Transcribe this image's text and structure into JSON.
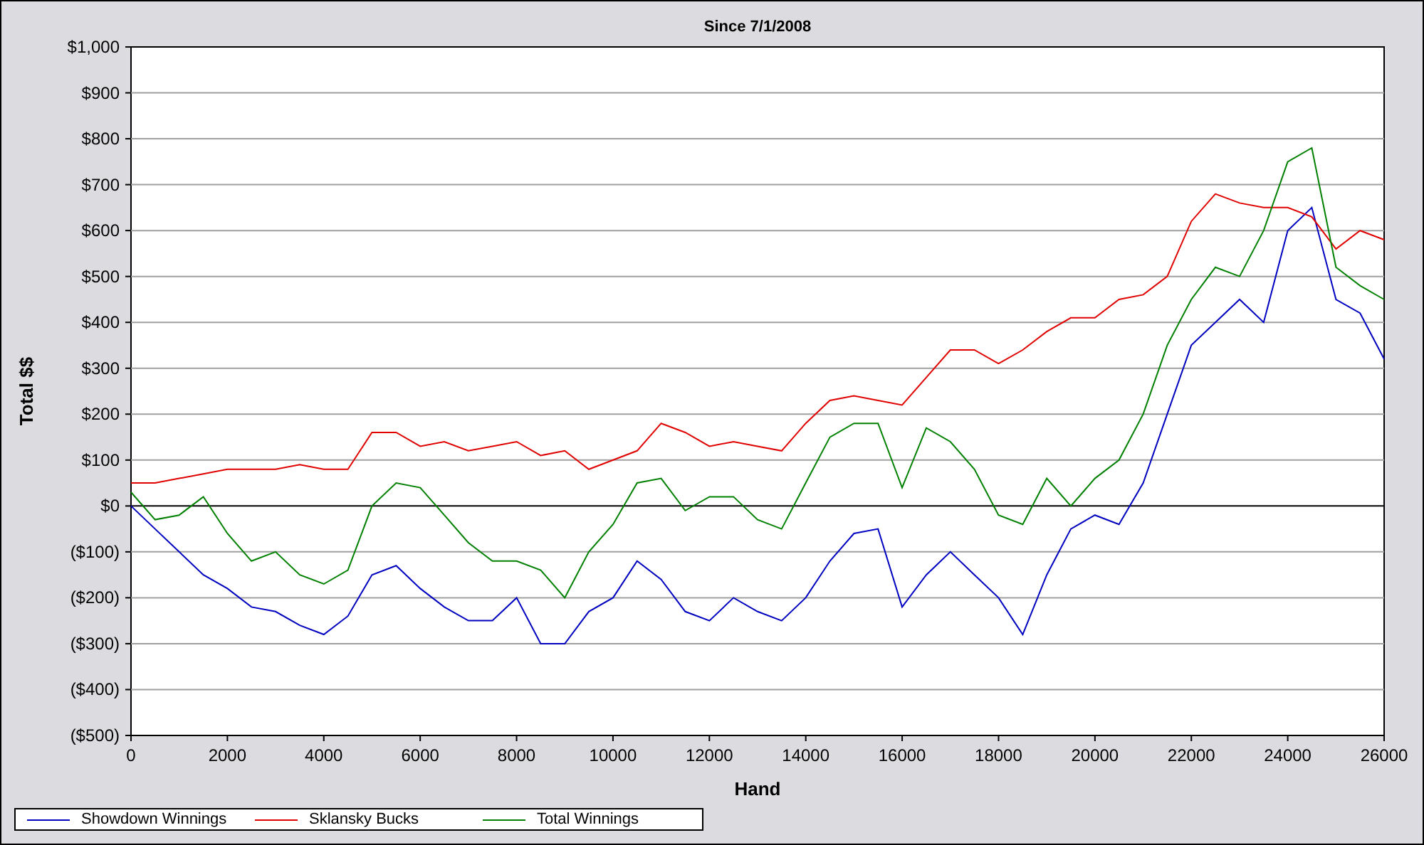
{
  "chart": {
    "chart_data": {
      "type": "line",
      "grid": true,
      "title": "Since 7/1/2008",
      "xlabel": "Hand",
      "ylabel": "Total $$",
      "x": [
        0,
        500,
        1000,
        1500,
        2000,
        2500,
        3000,
        3500,
        4000,
        4500,
        5000,
        5500,
        6000,
        6500,
        7000,
        7500,
        8000,
        8500,
        9000,
        9500,
        10000,
        10500,
        11000,
        11500,
        12000,
        12500,
        13000,
        13500,
        14000,
        14500,
        15000,
        15500,
        16000,
        16500,
        17000,
        17500,
        18000,
        18500,
        19000,
        19500,
        20000,
        20500,
        21000,
        21500,
        22000,
        22500,
        23000,
        23500,
        24000,
        24500,
        25000,
        25500,
        26000
      ],
      "series": [
        {
          "name": "Showdown Winnings",
          "color": "#0000c0",
          "values": [
            0,
            -50,
            -100,
            -150,
            -180,
            -220,
            -230,
            -260,
            -280,
            -240,
            -150,
            -130,
            -180,
            -220,
            -250,
            -250,
            -200,
            -300,
            -300,
            -230,
            -200,
            -120,
            -160,
            -230,
            -250,
            -200,
            -230,
            -250,
            -200,
            -120,
            -60,
            -50,
            -220,
            -150,
            -100,
            -150,
            -200,
            -280,
            -150,
            -50,
            -20,
            -40,
            50,
            200,
            350,
            400,
            450,
            400,
            600,
            650,
            450,
            420,
            320
          ]
        },
        {
          "name": "Sklansky Bucks",
          "color": "#e00000",
          "values": [
            50,
            50,
            60,
            70,
            80,
            80,
            80,
            90,
            80,
            80,
            160,
            160,
            130,
            140,
            120,
            130,
            140,
            110,
            120,
            80,
            100,
            120,
            180,
            160,
            130,
            140,
            130,
            120,
            180,
            230,
            240,
            230,
            220,
            280,
            340,
            340,
            310,
            340,
            380,
            410,
            410,
            450,
            460,
            500,
            620,
            680,
            660,
            650,
            650,
            630,
            560,
            600,
            580
          ]
        },
        {
          "name": "Total Winnings",
          "color": "#008000",
          "values": [
            30,
            -30,
            -20,
            20,
            -60,
            -120,
            -100,
            -150,
            -170,
            -140,
            0,
            50,
            40,
            -20,
            -80,
            -120,
            -120,
            -140,
            -200,
            -100,
            -40,
            50,
            60,
            -10,
            20,
            20,
            -30,
            -50,
            50,
            150,
            180,
            180,
            40,
            170,
            140,
            80,
            -20,
            -40,
            60,
            0,
            60,
            100,
            200,
            350,
            450,
            520,
            500,
            600,
            750,
            780,
            520,
            480,
            450
          ]
        }
      ],
      "xlim": [
        0,
        26000
      ],
      "ylim": [
        -500,
        1000
      ],
      "xticks": [
        0,
        2000,
        4000,
        6000,
        8000,
        10000,
        12000,
        14000,
        16000,
        18000,
        20000,
        22000,
        24000,
        26000
      ],
      "yticks": [
        {
          "value": 1000,
          "label": "$1,000"
        },
        {
          "value": 900,
          "label": "$900"
        },
        {
          "value": 800,
          "label": "$800"
        },
        {
          "value": 700,
          "label": "$700"
        },
        {
          "value": 600,
          "label": "$600"
        },
        {
          "value": 500,
          "label": "$500"
        },
        {
          "value": 400,
          "label": "$400"
        },
        {
          "value": 300,
          "label": "$300"
        },
        {
          "value": 200,
          "label": "$200"
        },
        {
          "value": 100,
          "label": "$100"
        },
        {
          "value": 0,
          "label": "$0"
        },
        {
          "value": -100,
          "label": "($100)"
        },
        {
          "value": -200,
          "label": "($200)"
        },
        {
          "value": -300,
          "label": "($300)"
        },
        {
          "value": -400,
          "label": "($400)"
        },
        {
          "value": -500,
          "label": "($500)"
        }
      ]
    }
  }
}
